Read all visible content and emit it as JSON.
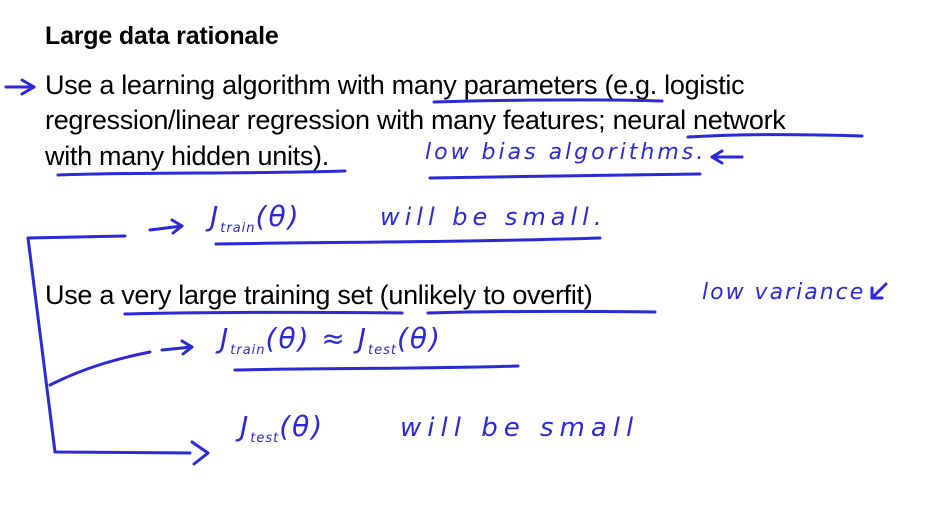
{
  "slide": {
    "title": "Large data rationale",
    "point1": {
      "line1": "Use a learning algorithm with many parameters (e.g. logistic",
      "line2": "regression/linear regression with many features; neural network",
      "line3": "with many hidden units)."
    },
    "point2": {
      "line1": "Use a very large training set (unlikely to overfit)"
    }
  },
  "handwriting": {
    "low_bias_note": "low bias algorithms.",
    "low_variance_note": "low variance",
    "eq_train_small_lhs": "J",
    "eq_train_small_sub": "train",
    "eq_train_small_arg": "(θ)",
    "eq_train_small_rhs": "will be small.",
    "eq_approx_lhs": "J",
    "eq_approx_lhs_sub": "train",
    "eq_approx_mid": "(θ) ≈ J",
    "eq_approx_rhs_sub": "test",
    "eq_approx_rhs_arg": "(θ)",
    "eq_test_small_lhs": "J",
    "eq_test_small_sub": "test",
    "eq_test_small_arg": "(θ)",
    "eq_test_small_rhs": "will be small"
  },
  "colors": {
    "ink": "#2a2ad8",
    "text": "#000000",
    "background": "#ffffff"
  }
}
